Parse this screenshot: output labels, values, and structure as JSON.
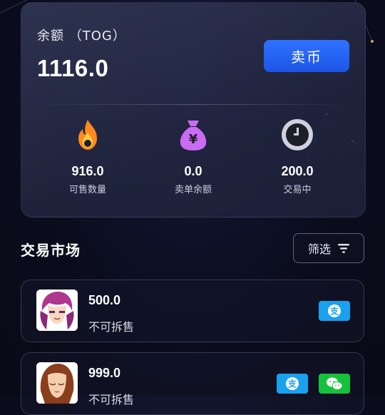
{
  "balance": {
    "label": "余额 （TOG）",
    "value": "1116.0",
    "sell_label": "卖币"
  },
  "stats": [
    {
      "icon": "flame-icon",
      "value": "916.0",
      "label": "可售数量",
      "color": "#ff8a1c"
    },
    {
      "icon": "money-bag-icon",
      "value": "0.0",
      "label": "卖单余额",
      "color": "#c96cf2"
    },
    {
      "icon": "clock-icon",
      "value": "200.0",
      "label": "交易中",
      "color": "#cfd1dc"
    }
  ],
  "market": {
    "title": "交易市场",
    "filter_label": "筛选"
  },
  "listings": [
    {
      "amount": "500.0",
      "status": "不可拆售",
      "payments": [
        "alipay"
      ]
    },
    {
      "amount": "999.0",
      "status": "不可拆售",
      "payments": [
        "alipay",
        "wechat"
      ]
    }
  ],
  "colors": {
    "accent": "#2563eb",
    "alipay": "#19a1ee",
    "wechat": "#16c13c"
  }
}
